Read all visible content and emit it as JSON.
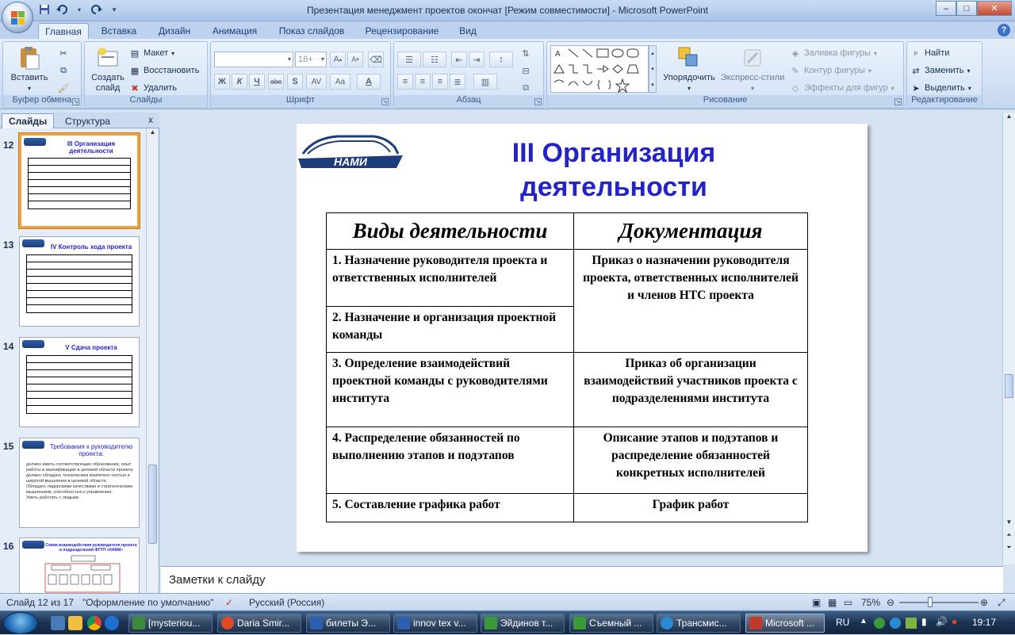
{
  "window": {
    "title": "Презентация менеджмент проектов окончат [Режим совместимости] - Microsoft PowerPoint",
    "minimize": "–",
    "maximize": "□",
    "close": "✕"
  },
  "qat": {
    "save": "save-icon",
    "undo": "undo-icon",
    "redo": "redo-icon",
    "customize": "▾"
  },
  "tabs": [
    "Главная",
    "Вставка",
    "Дизайн",
    "Анимация",
    "Показ слайдов",
    "Рецензирование",
    "Вид"
  ],
  "ribbon": {
    "clipboard": {
      "paste": "Вставить",
      "label": "Буфер обмена"
    },
    "slides": {
      "new_slide_1": "Создать",
      "new_slide_2": "слайд",
      "layout": "Макет",
      "reset": "Восстановить",
      "delete": "Удалить",
      "label": "Слайды"
    },
    "font": {
      "size": "18+",
      "label": "Шрифт",
      "bold": "Ж",
      "italic": "К",
      "underline": "Ч",
      "strike": "abc",
      "shadow": "S",
      "spacing": "AV",
      "case": "Aa",
      "color": "A"
    },
    "paragraph": {
      "label": "Абзац"
    },
    "drawing": {
      "arrange": "Упорядочить",
      "quick_styles": "Экспресс-стили",
      "fill": "Заливка фигуры",
      "outline": "Контур фигуры",
      "effects": "Эффекты для фигур",
      "label": "Рисование"
    },
    "editing": {
      "find": "Найти",
      "replace": "Заменить",
      "select": "Выделить",
      "label": "Редактирование"
    }
  },
  "pane": {
    "tab_slides": "Слайды",
    "tab_outline": "Структура",
    "close": "x",
    "thumbnails": [
      {
        "num": "12",
        "title": "III Организация деятельности",
        "selected": true
      },
      {
        "num": "13",
        "title": "IV Контроль хода проекта",
        "selected": false
      },
      {
        "num": "14",
        "title": "V Сдача проекта",
        "selected": false
      },
      {
        "num": "15",
        "title": "Требования к руководителю проекта:",
        "selected": false
      },
      {
        "num": "16",
        "title": "Схема взаимодействия руководителя проекта и подразделений ФГУП «НАМИ»",
        "selected": false
      }
    ],
    "slide15_bullets": [
      "должен иметь соответствующее образование, опыт работы и квалификацию в целевой области проекта;",
      "должен обладать техническим компетент-ностью и широтой мышления в целевой области;",
      "Обладать лидерскими качествами и стратегическим мышлением, способностью к управлению;",
      "Уметь работать с людьми."
    ]
  },
  "slide": {
    "logo_text": "НАМИ",
    "title": "III Организация деятельности",
    "table": {
      "headers": [
        "Виды деятельности",
        "Документация"
      ],
      "rows": [
        {
          "activity": "1. Назначение руководителя проекта и ответственных исполнителей"
        },
        {
          "activity": "2. Назначение и организация проектной команды"
        },
        {
          "activity": "3. Определение взаимодействий проектной команды с руководителями института",
          "doc": "Приказ об организации взаимодействий участников проекта с подразделениями института"
        },
        {
          "activity": "4. Распределение обязанностей по выполнению этапов и подэтапов",
          "doc": "Описание этапов и подэтапов и распределение обязанностей конкретных исполнителей"
        },
        {
          "activity": "5. Составление графика работ",
          "doc": "График работ"
        }
      ],
      "merged_doc_1_2": "Приказ о назначении руководителя проекта, ответственных исполнителей и членов НТС проекта"
    }
  },
  "notes": {
    "placeholder": "Заметки к слайду"
  },
  "status": {
    "slide_counter": "Слайд 12 из 17",
    "theme": "\"Оформление по умолчанию\"",
    "language": "Русский (Россия)",
    "zoom": "75%"
  },
  "taskbar": {
    "items": [
      {
        "label": "[mysteriou...",
        "color": "#3a8a3a"
      },
      {
        "label": "Daria Smir...",
        "color": "#e04a2a"
      },
      {
        "label": "билеты Э...",
        "color": "#2d5fb0"
      },
      {
        "label": "innov tex v...",
        "color": "#2d5fb0"
      },
      {
        "label": "Эйдинов т...",
        "color": "#3a9a3a"
      },
      {
        "label": "Съемный ...",
        "color": "#3a9a3a"
      },
      {
        "label": "Трансмис...",
        "color": "#2a8ad6"
      },
      {
        "label": "Microsoft ...",
        "color": "#c0392b",
        "active": true
      }
    ],
    "lang": "RU",
    "time": "19:17"
  },
  "colors": {
    "title_blue": "#2323c8",
    "selection_orange": "#f0a23c",
    "ribbon_blue": "#cfdff3"
  }
}
